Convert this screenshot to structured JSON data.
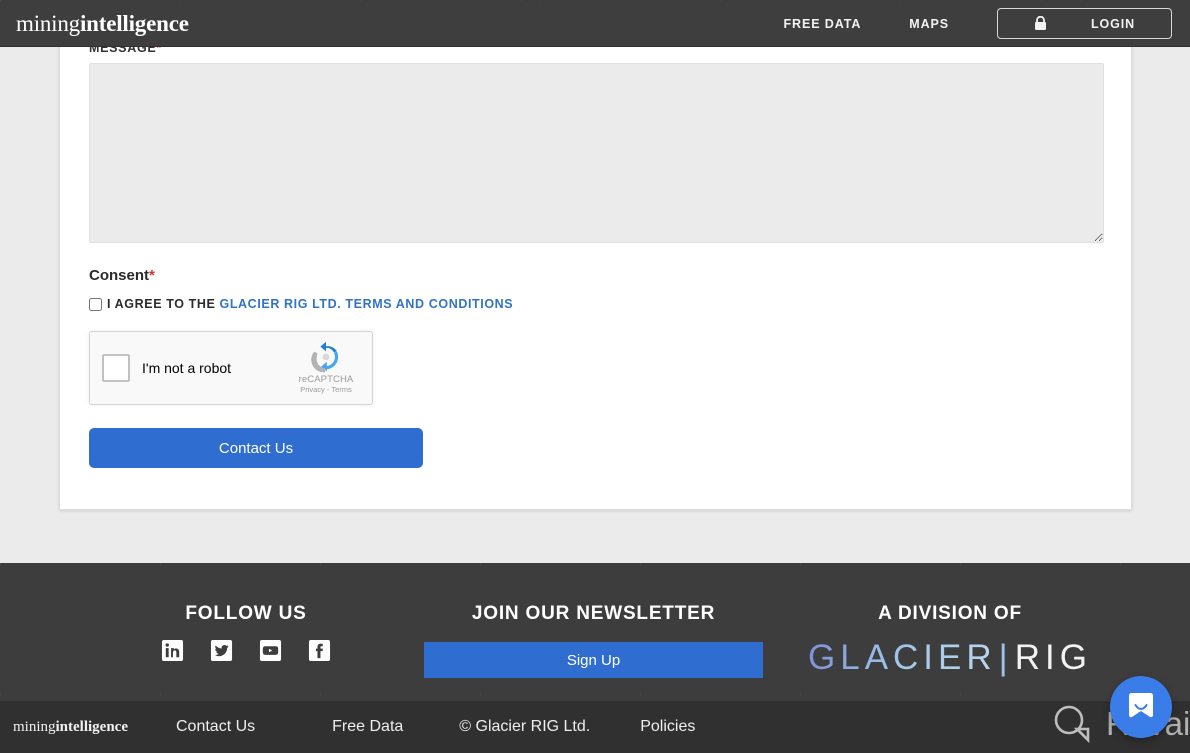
{
  "header": {
    "logo_light": "mining",
    "logo_bold": "intelligence",
    "nav": [
      {
        "label": "FREE DATA",
        "name": "free-data"
      },
      {
        "label": "MAPS",
        "name": "maps"
      }
    ],
    "login_label": "LOGIN",
    "lock_icon": "lock-icon"
  },
  "form": {
    "message_label": "MESSAGE",
    "message_required": "*",
    "message_value": "",
    "message_placeholder": "",
    "consent_title": "Consent",
    "consent_required": "*",
    "consent_prefix": "I AGREE TO THE ",
    "consent_link": "GLACIER RIG LTD. TERMS AND CONDITIONS",
    "checkbox_checked": false,
    "submit_label": "Contact Us"
  },
  "recaptcha": {
    "label": "I'm not a robot",
    "brand": "reCAPTCHA",
    "privacy": "Privacy",
    "separator": " - ",
    "terms": "Terms",
    "checked": false
  },
  "footer": {
    "follow_heading": "FOLLOW US",
    "socials": [
      {
        "name": "linkedin-icon",
        "label": "LinkedIn"
      },
      {
        "name": "twitter-icon",
        "label": "Twitter"
      },
      {
        "name": "youtube-icon",
        "label": "YouTube"
      },
      {
        "name": "facebook-icon",
        "label": "Facebook"
      }
    ],
    "newsletter_heading": "JOIN OUR NEWSLETTER",
    "signup_label": "Sign Up",
    "division_heading": "A DIVISION OF",
    "glacier_logo": {
      "left": "GLACIER",
      "bar": "|",
      "right": "RIG"
    }
  },
  "bottombar": {
    "logo_light": "mining",
    "logo_bold": "intelligence",
    "links": [
      {
        "label": "Contact Us",
        "name": "contact-us"
      },
      {
        "label": "Free Data",
        "name": "free-data"
      },
      {
        "label": "© Glacier RIG Ltd.",
        "name": "copyright"
      },
      {
        "label": "Policies",
        "name": "policies"
      }
    ]
  },
  "overlay": {
    "watermark_text": "Revain",
    "watermark_icon": "revain-logo-icon",
    "chat_icon": "chat-bubble-icon"
  },
  "colors": {
    "accent_blue": "#2f6dd0",
    "link_blue": "#3273c8",
    "header_dark": "#3e3e3e",
    "footer_dark": "#3d3d3d",
    "bottombar_dark": "#303030",
    "page_bg": "#ebebeb",
    "required_red": "#d0342c",
    "chat_blue": "#3b7de8"
  }
}
